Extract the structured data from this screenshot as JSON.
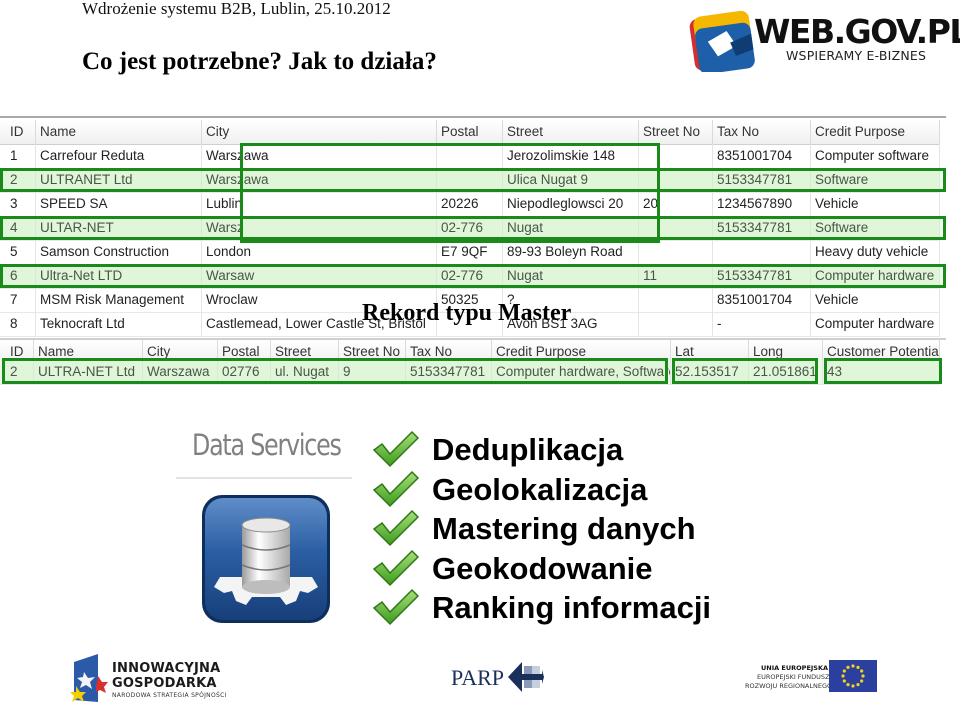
{
  "slide": {
    "subtitle": "Wdrożenie systemu B2B, Lublin, 25.10.2012",
    "title": "Co jest potrzebne? Jak to działa?",
    "overlay_label": "Rekord typu Master"
  },
  "brand": {
    "name": "WEB.GOV.PL",
    "tagline": "WSPIERAMY E-BIZNES",
    "logo_icon": "webgovpl-logo-icon"
  },
  "source_table": {
    "columns": [
      "ID",
      "Name",
      "City",
      "Postal",
      "Street",
      "Street No",
      "Tax No",
      "Credit Purpose"
    ],
    "rows": [
      [
        "1",
        "Carrefour Reduta",
        "Warszawa",
        "",
        "Jerozolimskie 148",
        "",
        "8351001704",
        "Computer software"
      ],
      [
        "2",
        "ULTRANET Ltd",
        "Warszawa",
        "",
        "Ulica Nugat 9",
        "",
        "5153347781",
        "Software"
      ],
      [
        "3",
        "SPEED SA",
        "Lublin",
        "20226",
        "Niepodleglowsci 20",
        "20",
        "1234567890",
        "Vehicle"
      ],
      [
        "4",
        "ULTAR-NET",
        "Warsz",
        "02-776",
        "Nugat",
        "",
        "5153347781",
        "Software"
      ],
      [
        "5",
        "Samson Construction",
        "London",
        "E7 9QF",
        "89-93 Boleyn Road",
        "",
        "",
        "Heavy duty vehicle"
      ],
      [
        "6",
        "Ultra-Net LTD",
        "Warsaw",
        "02-776",
        "Nugat",
        "11",
        "5153347781",
        "Computer hardware"
      ],
      [
        "7",
        "MSM Risk Management",
        "Wroclaw",
        "50325",
        "?",
        "",
        "8351001704",
        "Vehicle"
      ],
      [
        "8",
        "Teknocraft Ltd",
        "Castlemead, Lower Castle St, Bristol",
        "",
        "Avon BS1 3AG",
        "",
        "-",
        "Computer hardware"
      ]
    ],
    "highlighted_row_ids": [
      "2",
      "4",
      "6"
    ]
  },
  "master_table": {
    "columns": [
      "ID",
      "Name",
      "City",
      "Postal",
      "Street",
      "Street No",
      "Tax No",
      "Credit Purpose",
      "Lat",
      "Long",
      "Customer Potential"
    ],
    "rows": [
      [
        "2",
        "ULTRA-NET Ltd",
        "Warszawa",
        "02776",
        "ul. Nugat",
        "9",
        "5153347781",
        "Computer hardware, Software",
        "52.153517",
        "21.051861",
        "43"
      ]
    ]
  },
  "data_services": {
    "title": "Data Services",
    "icon": "database-gear-icon",
    "features": [
      "Deduplikacja",
      "Geolokalizacja",
      "Mastering danych",
      "Geokodowanie",
      "Ranking informacji"
    ]
  },
  "footer": {
    "innowacyjna": {
      "line1": "INNOWACYJNA",
      "line2": "GOSPODARKA",
      "line3": "NARODOWA STRATEGIA SPÓJNOŚCI"
    },
    "parp": {
      "label": "PARP"
    },
    "eu": {
      "line1": "UNIA EUROPEJSKA",
      "line2": "EUROPEJSKI FUNDUSZ",
      "line3": "ROZWOJU REGIONALNEGO"
    }
  },
  "colors": {
    "highlight_border": "#1a8a1a",
    "highlight_fill": "#eaf8e6",
    "ds_icon_blue": "#1f4f8f",
    "check_green": "#4caf2a"
  }
}
